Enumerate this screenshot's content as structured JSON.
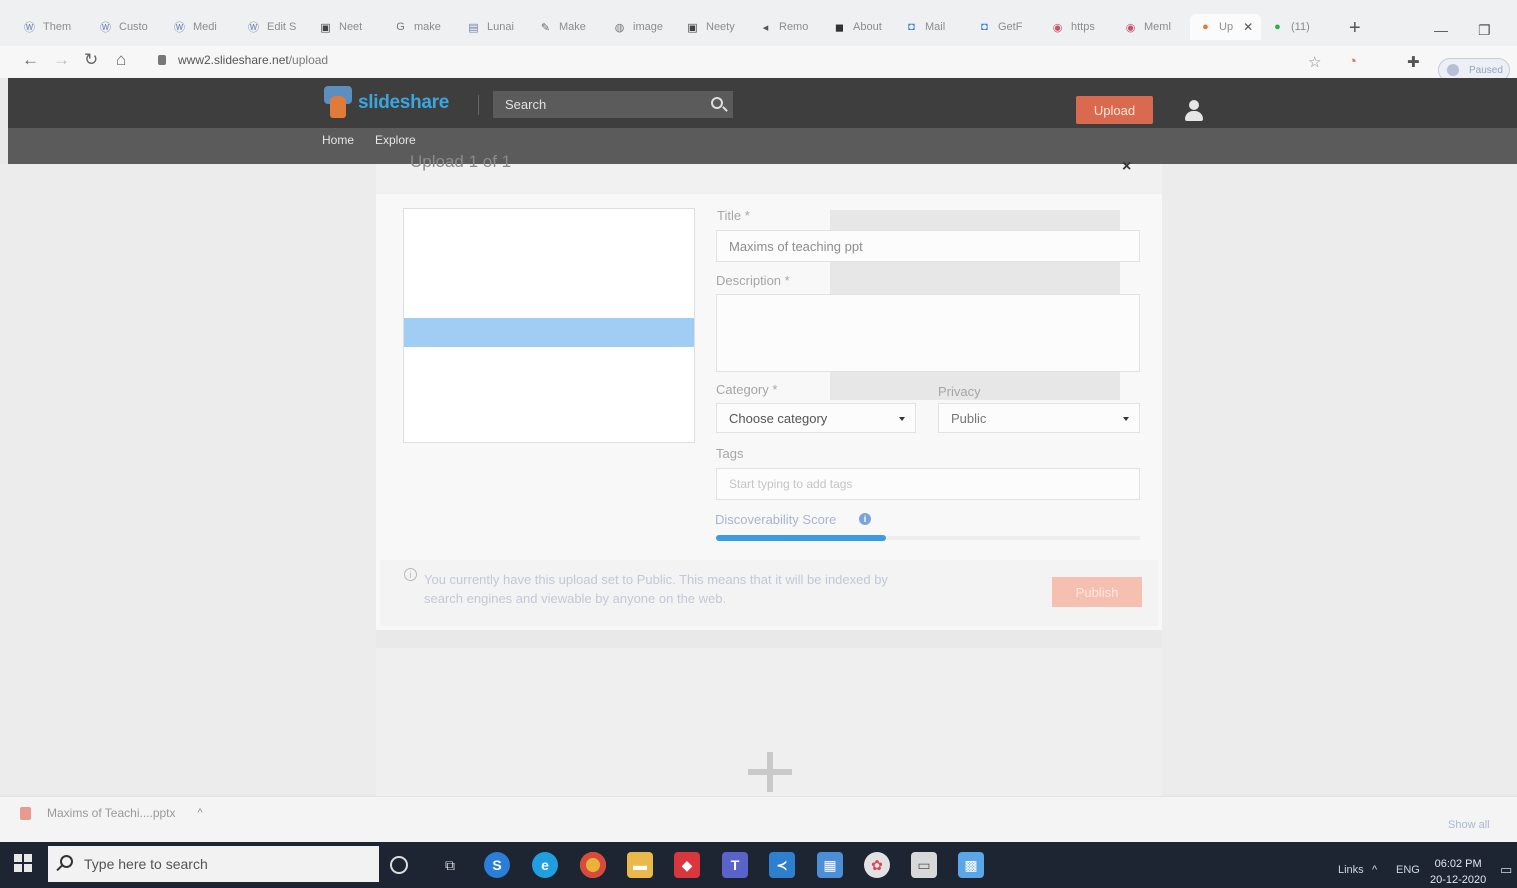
{
  "browser": {
    "tabs": [
      {
        "label": "Them"
      },
      {
        "label": "Custo"
      },
      {
        "label": "Medi"
      },
      {
        "label": "Edit S"
      },
      {
        "label": "Neet"
      },
      {
        "label": "make"
      },
      {
        "label": "Lunai"
      },
      {
        "label": "Make"
      },
      {
        "label": "image"
      },
      {
        "label": "Neety"
      },
      {
        "label": "Remo"
      },
      {
        "label": "About"
      },
      {
        "label": "Mail"
      },
      {
        "label": "GetF"
      },
      {
        "label": "https"
      },
      {
        "label": "Meml"
      },
      {
        "label": "Up"
      },
      {
        "label": "(11)"
      }
    ],
    "url_host": "www2.slideshare.net",
    "url_path": "/upload",
    "profile_label": "Paused"
  },
  "header": {
    "logo_text": "slideshare",
    "search_placeholder": "Search",
    "upload_label": "Upload",
    "nav": {
      "home": "Home",
      "explore": "Explore"
    }
  },
  "upload": {
    "panel_title": "Upload 1 of 1",
    "close_label": "×",
    "title_label": "Title *",
    "title_value": "Maxims of teaching ppt",
    "description_label": "Description *",
    "category_label": "Category *",
    "category_value": "Choose category",
    "privacy_label": "Privacy",
    "privacy_value": "Public",
    "tags_label": "Tags",
    "tags_placeholder": "Start typing to add tags",
    "discoverability_label": "Discoverability Score",
    "discoverability_fraction": 0.4,
    "notice_text": "You currently have this upload set to Public. This means that it will be indexed by search engines and viewable by anyone on the web.",
    "publish_label": "Publish"
  },
  "downloads": {
    "file_name": "Maxims of Teachi....pptx",
    "show_all": "Show all"
  },
  "taskbar": {
    "search_placeholder": "Type here to search",
    "tray_links": "Links",
    "tray_lang": "ENG",
    "time": "06:02 PM",
    "date": "20-12-2020"
  }
}
